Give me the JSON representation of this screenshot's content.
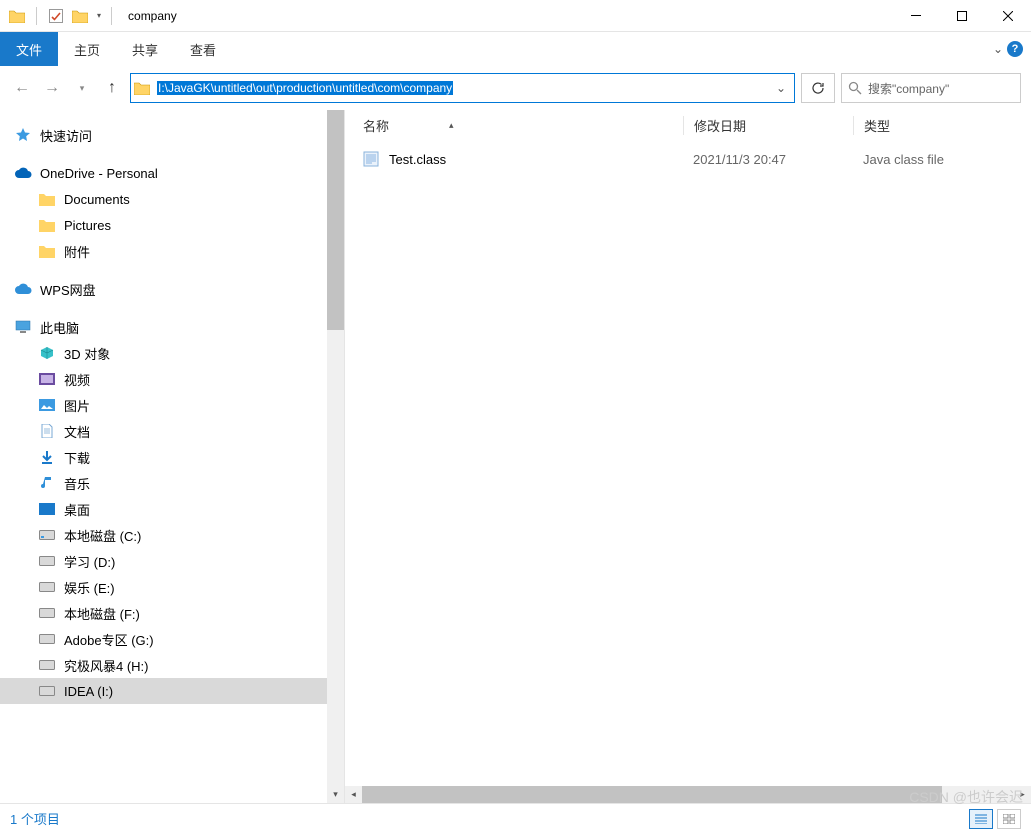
{
  "title": "company",
  "ribbon": {
    "file": "文件",
    "tabs": [
      "主页",
      "共享",
      "查看"
    ]
  },
  "address_path": "I:\\JavaGK\\untitled\\out\\production\\untitled\\com\\company",
  "search": {
    "placeholder": "搜索\"company\""
  },
  "nav": {
    "quick_access": "快速访问",
    "onedrive": "OneDrive - Personal",
    "onedrive_children": [
      "Documents",
      "Pictures",
      "附件"
    ],
    "wps": "WPS网盘",
    "this_pc": "此电脑",
    "pc_children": [
      "3D 对象",
      "视频",
      "图片",
      "文档",
      "下载",
      "音乐",
      "桌面",
      "本地磁盘 (C:)",
      "学习 (D:)",
      "娱乐 (E:)",
      "本地磁盘 (F:)",
      "Adobe专区 (G:)",
      "究极风暴4 (H:)",
      "IDEA (I:)"
    ]
  },
  "columns": {
    "name": "名称",
    "date": "修改日期",
    "type": "类型"
  },
  "files": [
    {
      "name": "Test.class",
      "date": "2021/11/3 20:47",
      "type": "Java class file"
    }
  ],
  "status": "1 个项目",
  "watermark": "CSDN @也许会迟"
}
